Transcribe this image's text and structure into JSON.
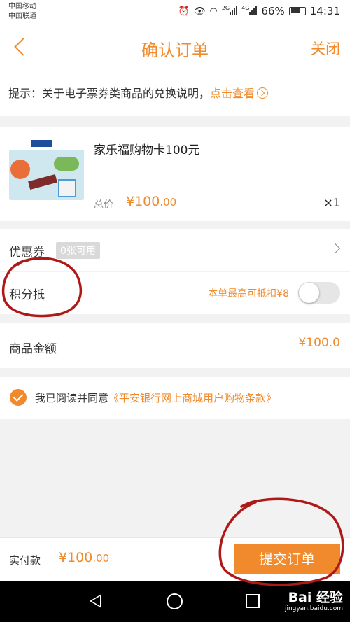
{
  "status_bar": {
    "carrier_1": "中国移动",
    "carrier_2": "中国联通",
    "network_1": "2G",
    "network_2": "4G",
    "battery": "66%",
    "time": "14:31"
  },
  "header": {
    "title": "确认订单",
    "close_label": "关闭"
  },
  "notice": {
    "text": "提示：关于电子票券类商品的兑换说明，",
    "link": "点击查看"
  },
  "product": {
    "name": "家乐福购物卡100元",
    "price_label": "总价",
    "price": "¥100",
    "price_decimal": ".00",
    "quantity": "×1"
  },
  "coupon": {
    "label": "优惠券",
    "badge": "0张可用"
  },
  "points": {
    "label": "积分抵",
    "hint": "本单最高可抵扣¥8",
    "enabled": false
  },
  "amount": {
    "label": "商品金额",
    "value": "¥100.0"
  },
  "agreement": {
    "text": "我已阅读并同意",
    "link": "《平安银行网上商城用户购物条款》",
    "checked": true
  },
  "footer": {
    "pay_label": "实付款",
    "pay_value": "¥100",
    "pay_decimal": ".00",
    "submit_label": "提交订单"
  },
  "watermark": {
    "brand": "Bai 经验",
    "url": "jingyan.baidu.com"
  },
  "colors": {
    "accent": "#f08a2c",
    "annotation": "#b01818"
  }
}
